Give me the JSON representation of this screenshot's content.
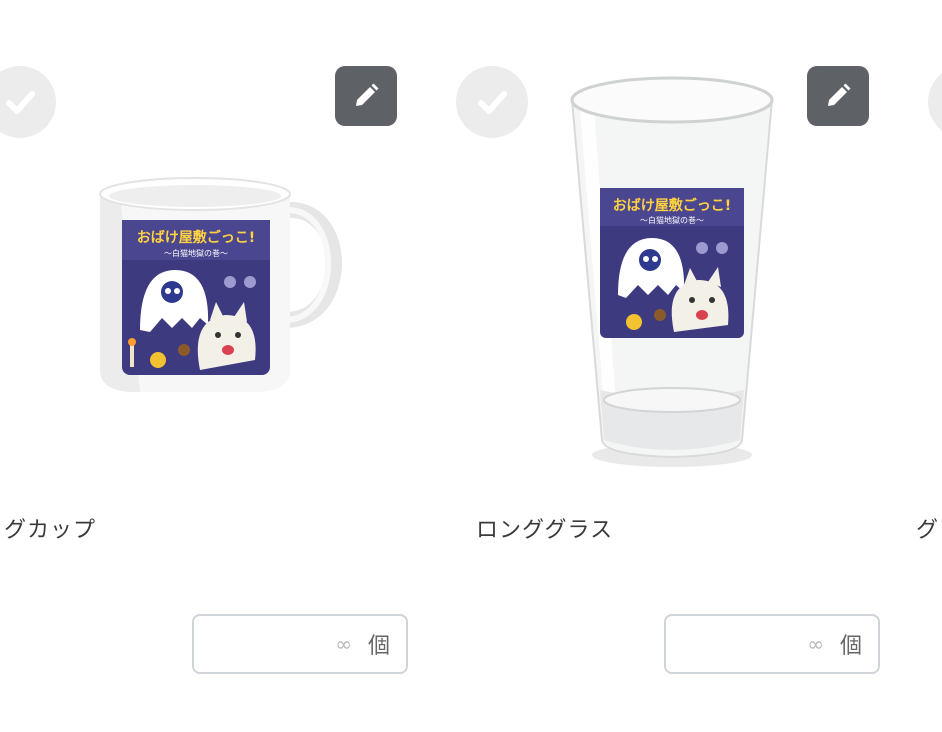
{
  "products": [
    {
      "name": "グカップ",
      "quantity": {
        "placeholder": "∞",
        "unit": "個"
      },
      "artwork": {
        "title": "おばけ屋敷ごっこ!",
        "subtitle": "〜白猫地獄の巻〜"
      }
    },
    {
      "name": "ロンググラス",
      "quantity": {
        "placeholder": "∞",
        "unit": "個"
      },
      "artwork": {
        "title": "おばけ屋敷ごっこ!",
        "subtitle": "〜白猫地獄の巻〜"
      }
    },
    {
      "name": "グ",
      "quantity": {
        "placeholder": "",
        "unit": ""
      }
    }
  ],
  "icons": {
    "select": "check-icon",
    "edit": "pencil-icon"
  },
  "colors": {
    "edit_button_bg": "#5e6266",
    "check_bg": "#ececec",
    "input_border": "#cfd4d9",
    "artwork_bg": "#3d3a80",
    "artwork_title": "#ffd23f"
  }
}
